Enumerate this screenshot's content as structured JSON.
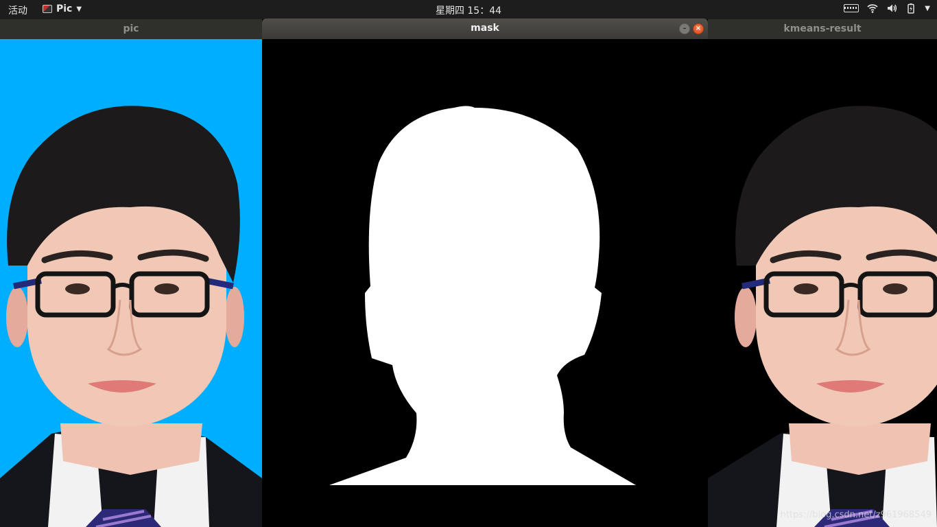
{
  "topbar": {
    "activities": "活动",
    "app_name": "Pic",
    "clock": "星期四 15：44"
  },
  "windows": {
    "pic": {
      "title": "pic"
    },
    "mask": {
      "title": "mask"
    },
    "kmeans": {
      "title": "kmeans-result"
    }
  },
  "colors": {
    "pic_background": "#00aeff",
    "mask_background": "#000000",
    "mask_foreground": "#ffffff",
    "kmeans_background": "#000000",
    "close_button": "#e5521f"
  },
  "icons": {
    "keyboard": "keyboard-icon",
    "wifi": "wifi-icon",
    "volume": "volume-icon",
    "battery": "battery-icon",
    "menu": "chevron-down-icon"
  },
  "watermark": "https://blog.csdn.net/z961968549"
}
